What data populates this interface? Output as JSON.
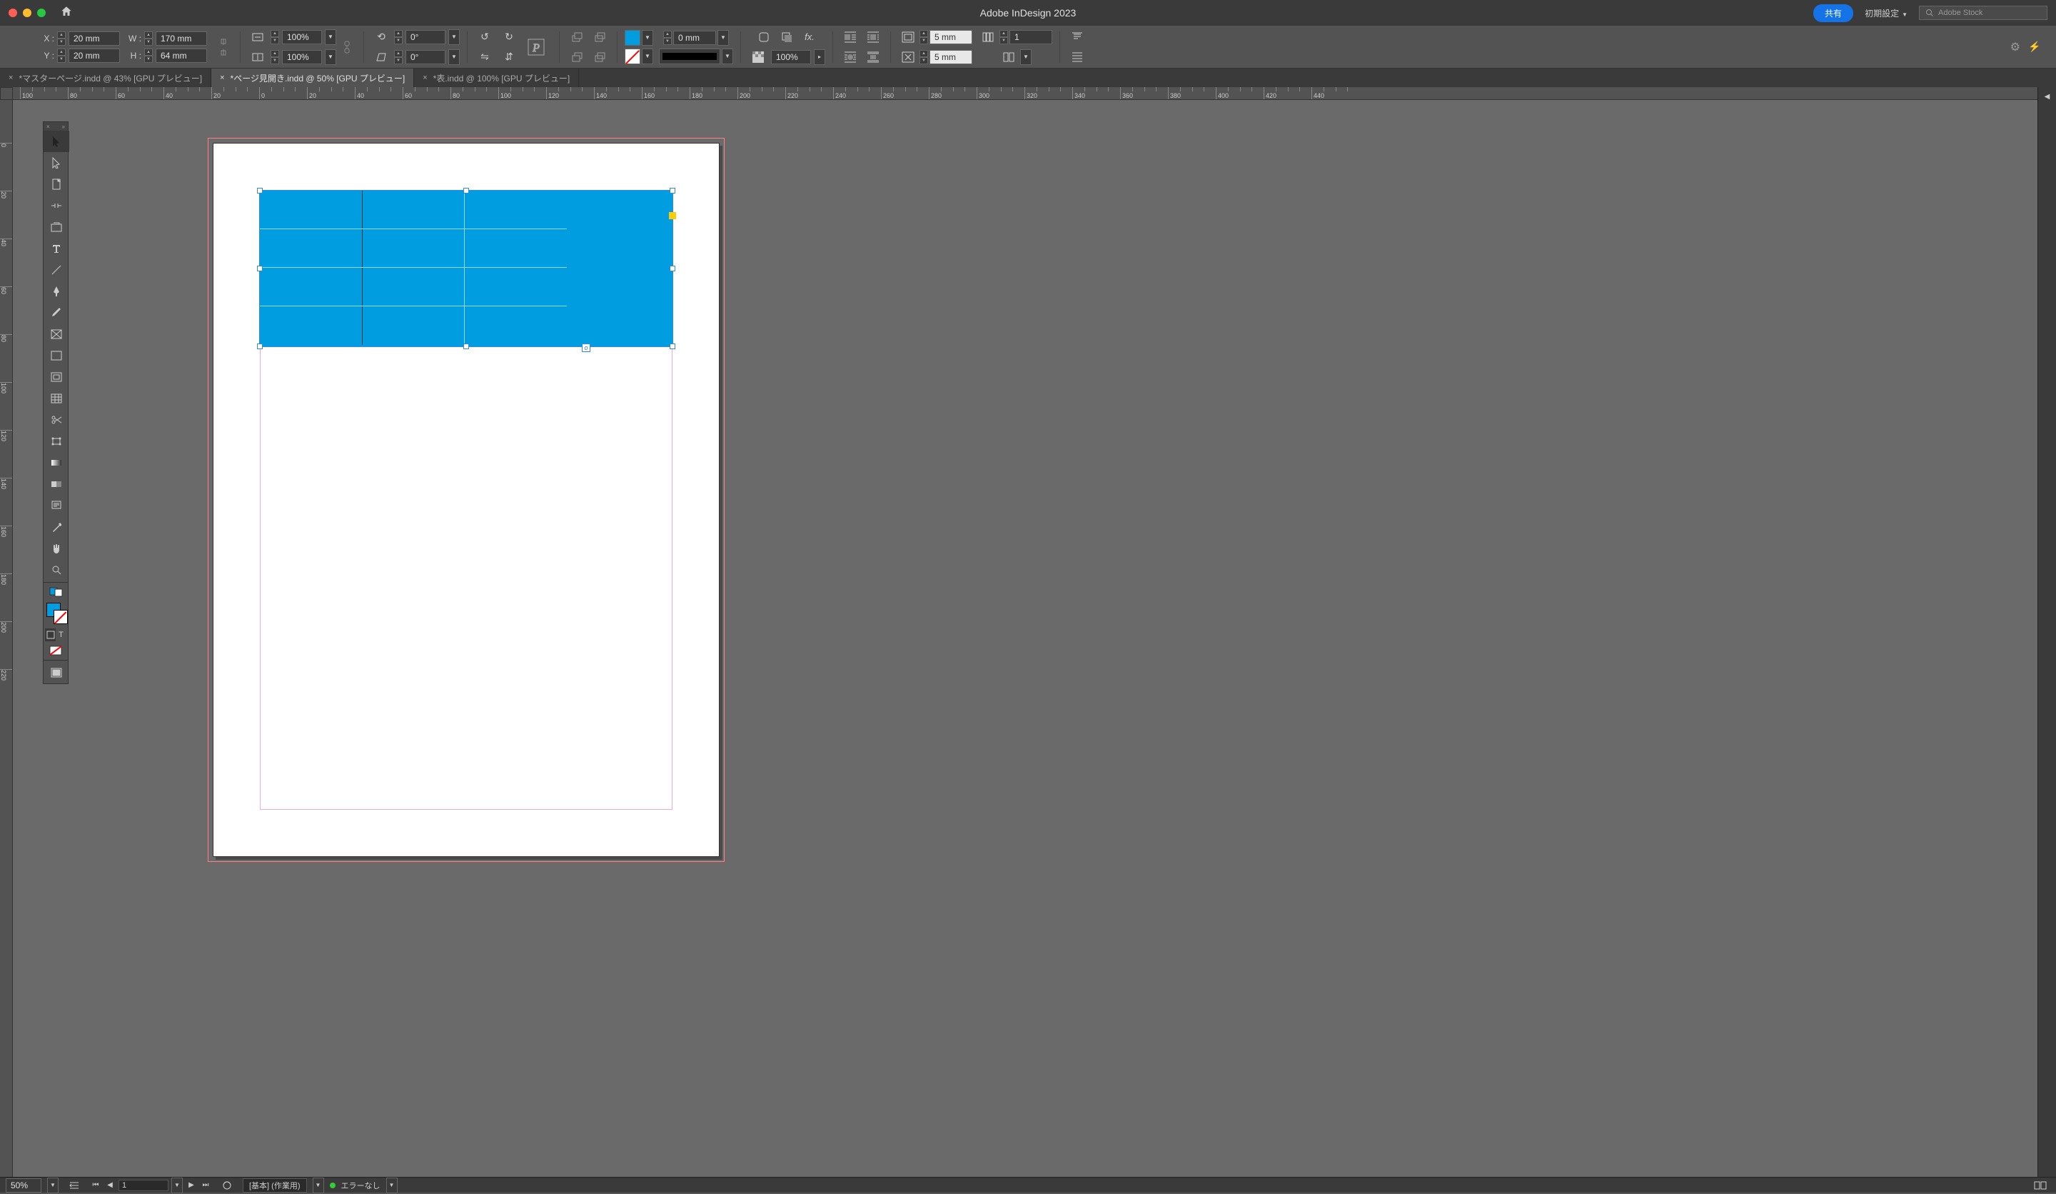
{
  "titlebar": {
    "app_title": "Adobe InDesign 2023",
    "share_label": "共有",
    "workspace_label": "初期設定",
    "stock_placeholder": "Adobe Stock"
  },
  "controls": {
    "x_label": "X :",
    "y_label": "Y :",
    "w_label": "W :",
    "h_label": "H :",
    "x_val": "20 mm",
    "y_val": "20 mm",
    "w_val": "170 mm",
    "h_val": "64 mm",
    "scale_x": "100%",
    "scale_y": "100%",
    "rotate": "0°",
    "shear": "0°",
    "stroke_weight": "0 mm",
    "opacity": "100%",
    "col_gap1": "5 mm",
    "col_gap2": "5 mm",
    "cols": "1"
  },
  "tabs": [
    {
      "label": "*マスターページ.indd @ 43% [GPU プレビュー]"
    },
    {
      "label": "*ページ見開き.indd @ 50% [GPU プレビュー]"
    },
    {
      "label": "*表.indd @ 100% [GPU プレビュー]"
    }
  ],
  "ruler_h": [
    -100,
    -80,
    -60,
    -40,
    -20,
    0,
    20,
    40,
    60,
    80,
    100,
    120,
    140,
    160,
    180,
    200,
    220,
    240,
    260,
    280,
    300,
    320,
    340,
    360,
    380,
    400,
    420,
    440
  ],
  "ruler_v": [
    0,
    20,
    40,
    60,
    80,
    100,
    120,
    140,
    160,
    180,
    200,
    220
  ],
  "status": {
    "zoom": "50%",
    "page": "1",
    "layer": "[基本] (作業用)",
    "errors": "エラーなし"
  }
}
